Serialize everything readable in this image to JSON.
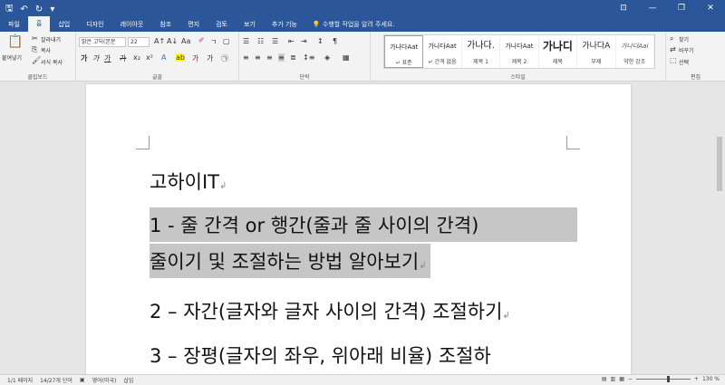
{
  "qat": {
    "save": "🖫",
    "undo": "↶",
    "redo": "↻",
    "more": "▾"
  },
  "window": {
    "ribbon_opts": "⊡",
    "minimize": "—",
    "restore": "❐",
    "close": "✕"
  },
  "tabs": [
    "파일",
    "홈",
    "삽입",
    "디자인",
    "레이아웃",
    "참조",
    "편지",
    "검토",
    "보기",
    "추가 기능"
  ],
  "tellme": "수행할 작업을 알려 주세요.",
  "clipboard": {
    "paste": "붙여넣기",
    "cut": "잘라내기",
    "copy": "복사",
    "format_painter": "서식 복사",
    "label": "클립보드"
  },
  "font": {
    "name": "맑은 고딕(본문",
    "size": "22",
    "label": "글꼴"
  },
  "paragraph": {
    "label": "단락"
  },
  "styles": {
    "label": "스타일",
    "items": [
      {
        "sample": "가나다Aat",
        "name": "↵ 표준"
      },
      {
        "sample": "가나다Aat",
        "name": "↵ 간격 없음"
      },
      {
        "sample": "가나다.",
        "name": "제목 1"
      },
      {
        "sample": "가나다Aat",
        "name": "제목 2"
      },
      {
        "sample": "가나디",
        "name": "제목"
      },
      {
        "sample": "가나다A",
        "name": "부제"
      },
      {
        "sample": "가나다Aai",
        "name": "약한 강조"
      }
    ]
  },
  "editing": {
    "find": "찾기",
    "replace": "바꾸기",
    "select": "선택",
    "label": "편집"
  },
  "document": {
    "line1": "고하이IT",
    "line2": "1 - 줄 간격 or 행간(줄과 줄 사이의 간격)",
    "line3": "줄이기 및 조절하는 방법 알아보기",
    "line4": "2 – 자간(글자와 글자 사이의 간격) 조절하기",
    "line5": "3 – 장평(글자의 좌우, 위아래 비율) 조절하"
  },
  "status": {
    "page": "1/1 페이지",
    "words": "14/27개 단어",
    "lang": "영어(미국)",
    "mode": "삽입",
    "zoom": "130 %"
  }
}
